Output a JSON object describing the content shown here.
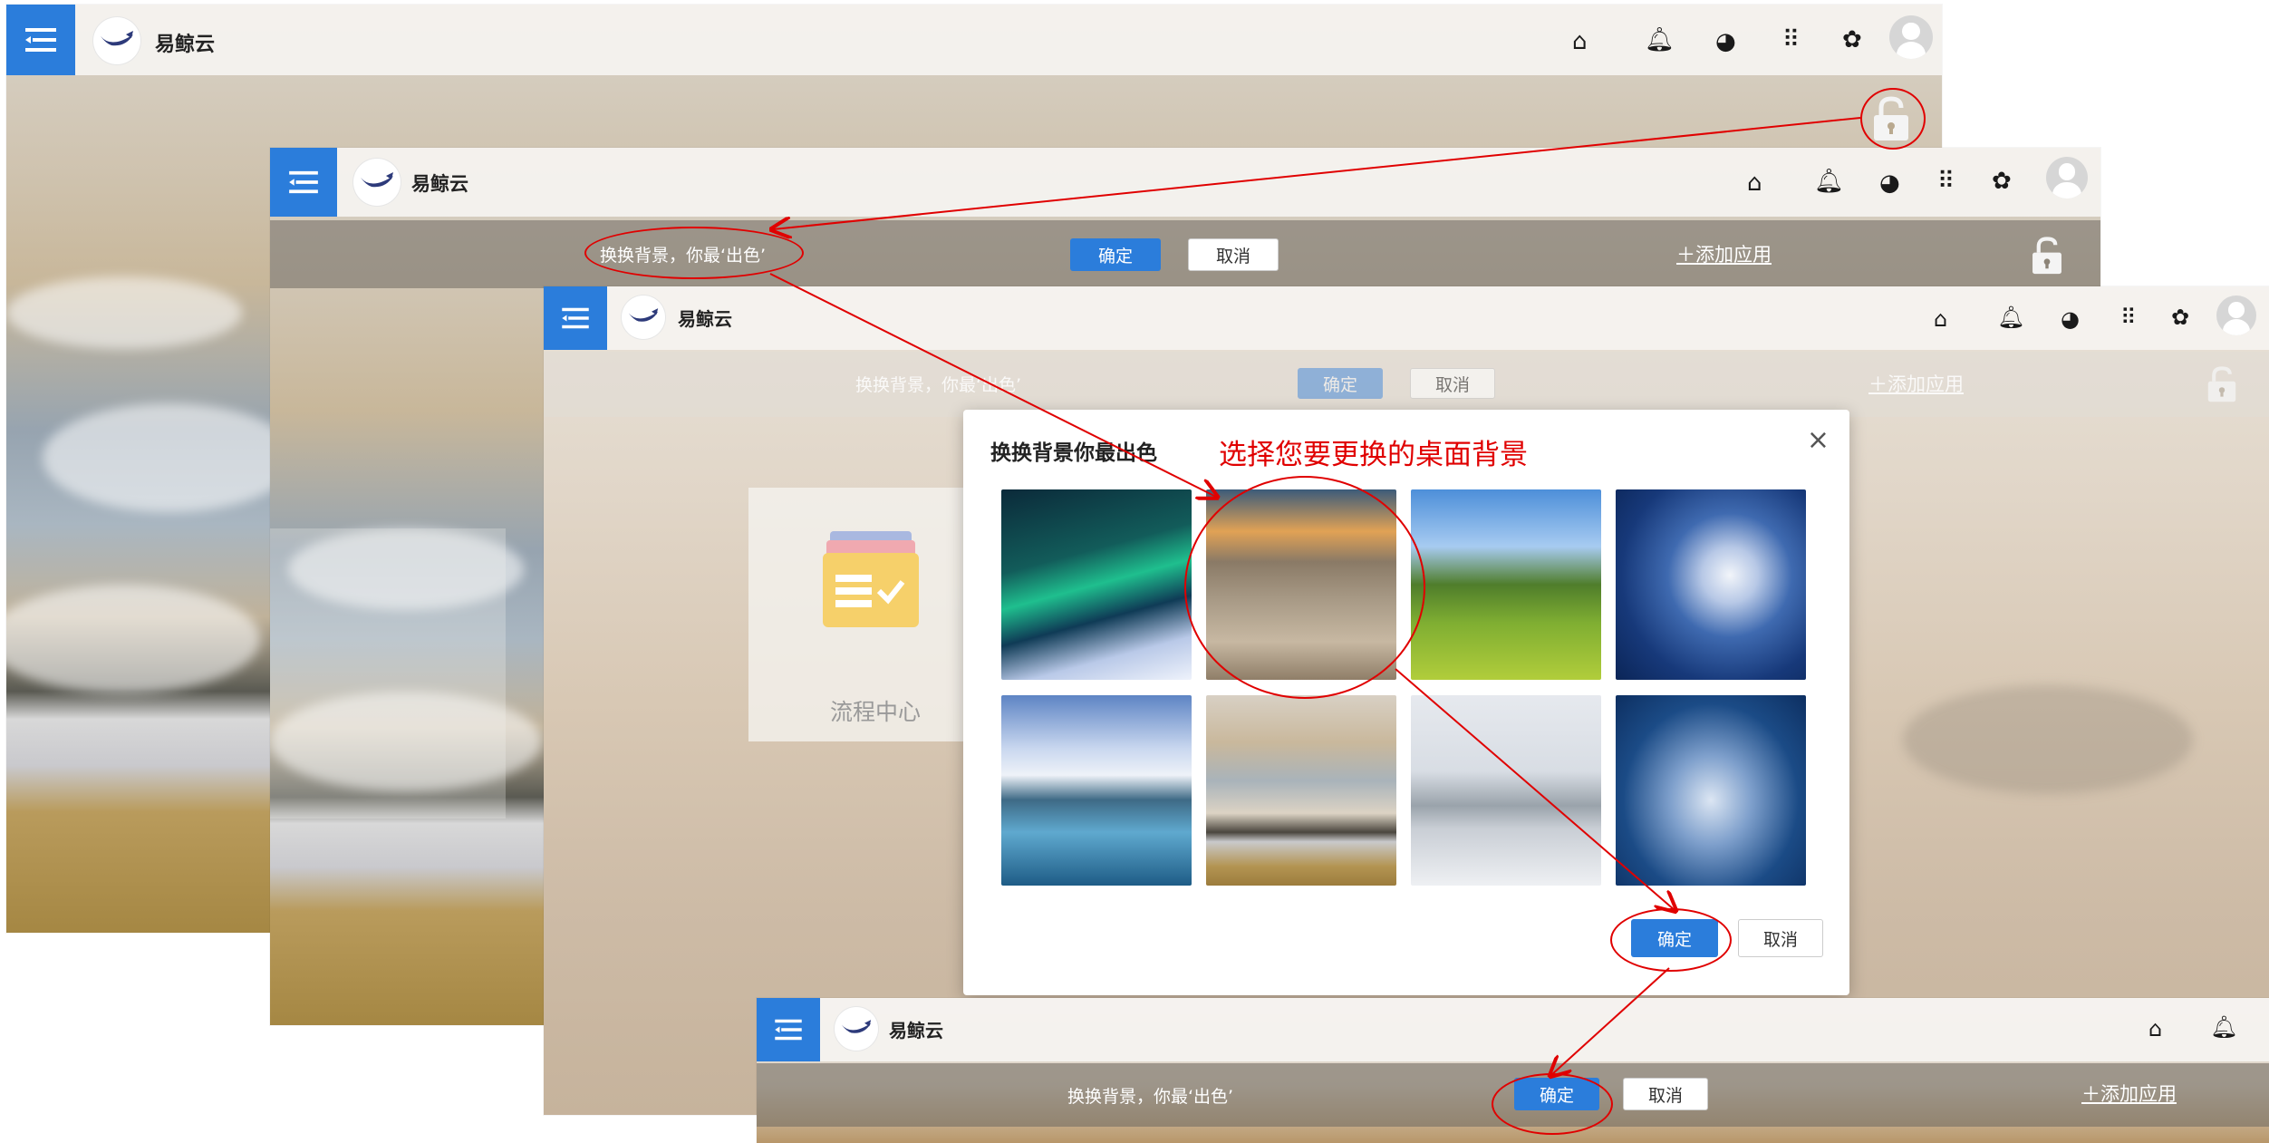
{
  "app": {
    "brand": "易鲸云"
  },
  "toolbar": {
    "icons": [
      "home-icon",
      "bell-icon",
      "palette-icon",
      "apps-grid-icon",
      "gear-icon",
      "avatar"
    ]
  },
  "bg_strip": {
    "text": "换换背景，你最‘出色’",
    "confirm": "确定",
    "cancel": "取消",
    "add_app": "添加应用"
  },
  "dialog": {
    "title": "换换背景你最出色",
    "close": "×",
    "confirm": "确定",
    "cancel": "取消",
    "thumbnails": [
      "aurora",
      "beach-rocks",
      "green-hills",
      "ocean-wave",
      "snow-mountains",
      "sunset-plain",
      "misty-lake",
      "whale-sky"
    ]
  },
  "annotation": {
    "note": "选择您要更换的桌面背景",
    "color": "#e00000"
  },
  "desktop": {
    "tile_label": "流程中心"
  },
  "colors": {
    "accent": "#2b7ddb",
    "annotation_red": "#e00000"
  }
}
